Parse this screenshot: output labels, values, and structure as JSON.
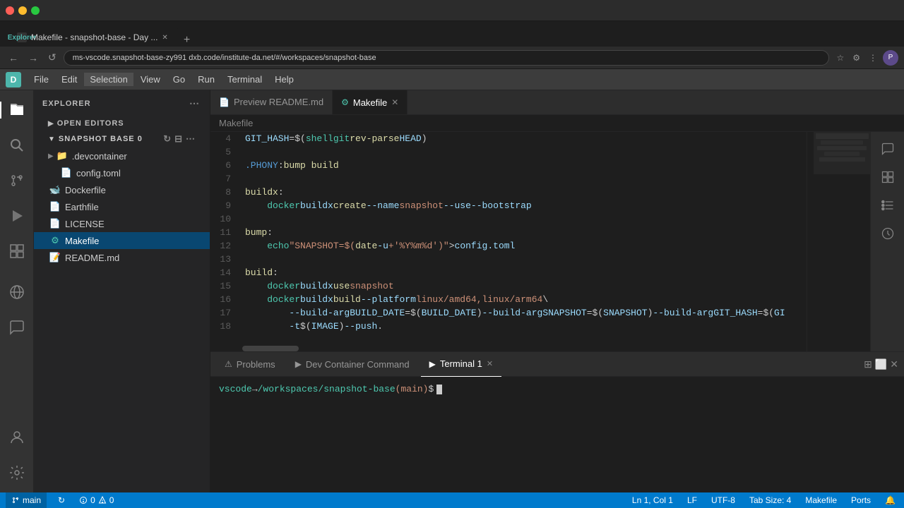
{
  "browser": {
    "tab_title": "Makefile - snapshot-base - Day ...",
    "tab_favicon": "D",
    "url": "ms-vscode.snapshot-base-zy991 dxb.code/institute-da.net/#/workspaces/snapshot-base",
    "new_tab_label": "+",
    "nav_back": "←",
    "nav_forward": "→",
    "nav_refresh": "↺",
    "profile_initial": "P"
  },
  "vscode": {
    "title": "Makefile - snapshot-base - Day ...",
    "activity_bar": {
      "explorer_label": "Explorer",
      "search_label": "Search",
      "source_control_label": "Source Control",
      "run_debug_label": "Run and Debug",
      "extensions_label": "Extensions",
      "remote_label": "Remote Explorer",
      "accounts_label": "Accounts",
      "settings_label": "Settings"
    },
    "menu": {
      "file": "File",
      "edit": "Edit",
      "selection": "Selection",
      "view": "View",
      "go": "Go",
      "run": "Run",
      "terminal": "Terminal",
      "help": "Help"
    },
    "sidebar": {
      "title": "EXPLORER",
      "section": "SNAPSHOT BASE 0",
      "open_editors_label": "OPEN EDITORS",
      "files": [
        {
          "name": ".devcontainer",
          "type": "folder",
          "indent": 0
        },
        {
          "name": "config.toml",
          "type": "toml",
          "indent": 1
        },
        {
          "name": "Dockerfile",
          "type": "dockerfile",
          "indent": 0
        },
        {
          "name": "Earthfile",
          "type": "generic",
          "indent": 0
        },
        {
          "name": "LICENSE",
          "type": "generic",
          "indent": 0
        },
        {
          "name": "Makefile",
          "type": "makefile",
          "indent": 0,
          "active": true
        },
        {
          "name": "README.md",
          "type": "md",
          "indent": 0
        }
      ]
    },
    "tabs": [
      {
        "label": "Preview README.md",
        "icon": "📄",
        "active": false
      },
      {
        "label": "Makefile",
        "icon": "⚙",
        "active": true,
        "closable": true
      }
    ],
    "breadcrumb": {
      "file": "Makefile"
    },
    "code": {
      "lines": [
        {
          "num": 4,
          "content": "GIT_HASH=$(shell git rev-parse HEAD)"
        },
        {
          "num": 5,
          "content": ""
        },
        {
          "num": 6,
          "content": ".PHONY: bump build"
        },
        {
          "num": 7,
          "content": ""
        },
        {
          "num": 8,
          "content": "buildx:"
        },
        {
          "num": 9,
          "content": "    docker buildx create --name snapshot --use --bootstrap"
        },
        {
          "num": 10,
          "content": ""
        },
        {
          "num": 11,
          "content": "bump:"
        },
        {
          "num": 12,
          "content": "    echo \"SNAPSHOT=$(date -u +'%Y%m%d')\" > config.toml"
        },
        {
          "num": 13,
          "content": ""
        },
        {
          "num": 14,
          "content": "build:"
        },
        {
          "num": 15,
          "content": "    docker buildx use snapshot"
        },
        {
          "num": 16,
          "content": "    docker buildx build --platform linux/amd64,linux/arm64 \\"
        },
        {
          "num": 17,
          "content": "        --build-arg BUILD_DATE=$(BUILD_DATE) --build-arg SNAPSHOT=$(SNAPSHOT) --build-arg GIT_HASH=$(GI"
        },
        {
          "num": 18,
          "content": "        -t $(IMAGE) --push ."
        }
      ]
    },
    "terminal": {
      "tabs": [
        {
          "label": "Problems",
          "icon": "⚠",
          "active": false
        },
        {
          "label": "Dev Container Command",
          "icon": "▶",
          "active": false
        },
        {
          "label": "Terminal 1",
          "icon": "▶",
          "active": true,
          "closable": true
        }
      ],
      "prompt_user": "vscode",
      "prompt_arrow": " → ",
      "prompt_path": "/workspaces/snapshot-base",
      "prompt_branch": " (main)",
      "prompt_dollar": " $"
    },
    "status_bar": {
      "branch": "main",
      "sync_icon": "↻",
      "errors": "0",
      "warnings": "0",
      "line_col": "Ln 1, Col 1",
      "lf": "LF",
      "encoding": "UTF-8",
      "tab_size": "Tab Size: 4",
      "language": "Makefile",
      "ports": "Ports",
      "bell": "🔔"
    }
  }
}
